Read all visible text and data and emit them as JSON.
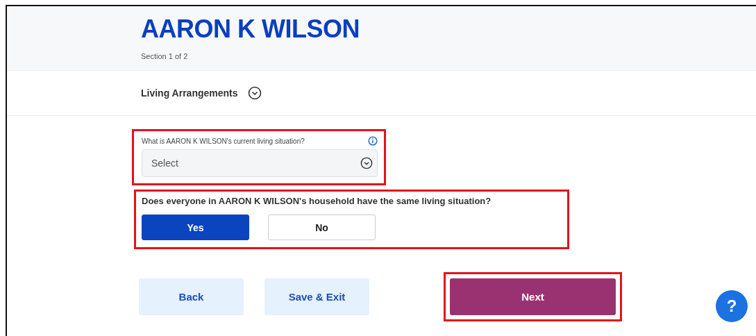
{
  "header": {
    "title": "AARON K WILSON",
    "subtitle": "Section 1 of 2"
  },
  "section": {
    "title": "Living Arrangements",
    "expanded": false
  },
  "living_situation": {
    "label": "What is AARON K WILSON's current living situation?",
    "placeholder": "Select",
    "highlighted": true
  },
  "household_question": {
    "label": "Does everyone in AARON K WILSON's household have the same living situation?",
    "highlighted": true,
    "options": [
      {
        "label": "Yes",
        "selected": true
      },
      {
        "label": "No",
        "selected": false
      }
    ]
  },
  "buttons": [
    {
      "label": "Back",
      "kind": "secondary",
      "highlighted": false
    },
    {
      "label": "Save & Exit",
      "kind": "secondary",
      "highlighted": false
    },
    {
      "label": "Next",
      "kind": "primary",
      "highlighted": true
    }
  ],
  "help": {
    "label": "?"
  }
}
